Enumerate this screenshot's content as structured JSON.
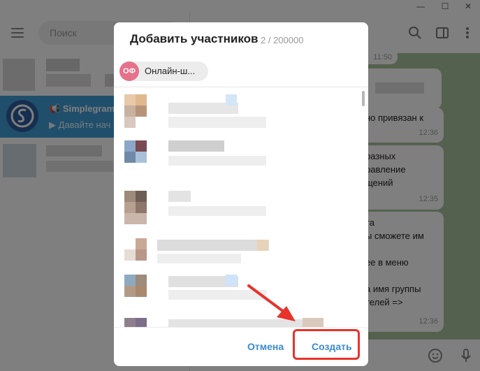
{
  "sidebar": {
    "search_placeholder": "Поиск",
    "selected_chat": {
      "name": "Simplegram",
      "subtitle": "Давайте нач"
    }
  },
  "chat": {
    "messages": [
      {
        "text": "",
        "time": "11:50"
      },
      {
        "text": "но привязан к",
        "time": "12:36"
      },
      {
        "text": "разных\nравление\nщений",
        "time": "12:35"
      },
      {
        "text": "та\nы сможете им\n\nее в меню\n\nа имя группы\nтелей =>",
        "time": "12:36"
      }
    ]
  },
  "modal": {
    "title": "Добавить участников",
    "count": "2 / 200000",
    "chip": {
      "initials": "ОФ",
      "label": "Онлайн-ш..."
    },
    "cancel_label": "Отмена",
    "create_label": "Создать"
  },
  "colors": {
    "accent": "#419fd9",
    "annotation": "#e8332a",
    "chip_avatar": "#e5718a",
    "chat_bg": "#a9c29c"
  }
}
